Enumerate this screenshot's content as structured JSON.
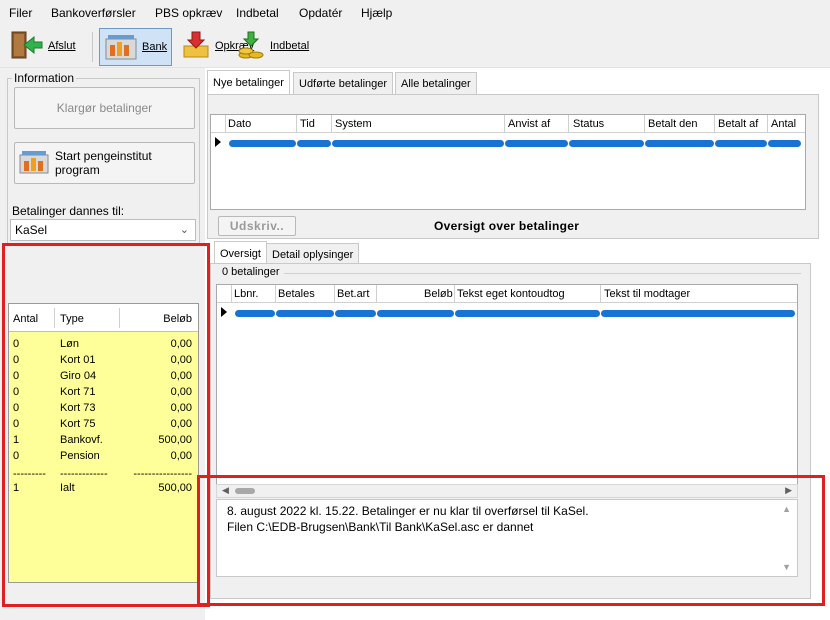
{
  "menu": [
    "Filer",
    "Bankoverførsler",
    "PBS opkræv",
    "Indbetal",
    "Opdatér",
    "Hjælp"
  ],
  "toolbar": {
    "exit_label": "Afslut",
    "bank_label": "Bank",
    "collect_label": "Opkræv",
    "deposit_label": "Indbetal"
  },
  "left": {
    "info_legend": "Information",
    "prepare_label": "Klargør betalinger",
    "start_bank_label": "Start pengeinstitut program",
    "created_for_label": "Betalinger dannes til:",
    "recipient_value": "KaSel"
  },
  "summary": {
    "headers": [
      "Antal",
      "Type",
      "Beløb"
    ],
    "rows": [
      [
        "0",
        "Løn",
        "0,00"
      ],
      [
        "0",
        "Kort 01",
        "0,00"
      ],
      [
        "0",
        "Giro 04",
        "0,00"
      ],
      [
        "0",
        "Kort 71",
        "0,00"
      ],
      [
        "0",
        "Kort 73",
        "0,00"
      ],
      [
        "0",
        "Kort 75",
        "0,00"
      ],
      [
        "1",
        "Bankovf.",
        "500,00"
      ],
      [
        "0",
        "Pension",
        "0,00"
      ]
    ],
    "separator": [
      "---------",
      "-------------",
      "----------------"
    ],
    "total": [
      "1",
      "Ialt",
      "500,00"
    ]
  },
  "top_tabs": [
    "Nye betalinger",
    "Udførte betalinger",
    "Alle betalinger"
  ],
  "pay_grid_headers": [
    "Dato",
    "Tid",
    "System",
    "Anvist af",
    "Status",
    "Betalt den",
    "Betalt af",
    "Antal"
  ],
  "print_label": "Udskriv..",
  "overview_title": "Oversigt over betalinger",
  "bottom_tabs": [
    "Oversigt",
    "Detail oplysinger"
  ],
  "count_label": "0 betalinger",
  "detail_grid_headers": [
    "Lbnr.",
    "Betales",
    "Bet.art",
    "Beløb",
    "Tekst eget kontoudtog",
    "Tekst til modtager"
  ],
  "log": [
    "8. august 2022 kl. 15.22. Betalinger er nu klar til overførsel til KaSel.",
    "Filen C:\\EDB-Brugsen\\Bank\\Til Bank\\KaSel.asc er dannet"
  ],
  "colors": {
    "highlight_red": "#e02020",
    "summary_yellow": "#ffff99",
    "row_pill_blue": "#1874d4"
  }
}
